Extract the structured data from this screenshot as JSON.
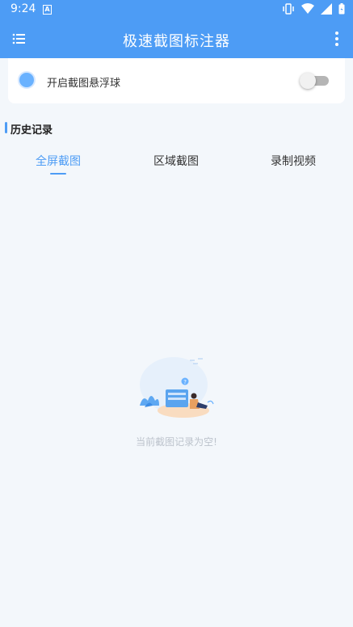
{
  "status_bar": {
    "time": "9:24",
    "notification_letter": "A"
  },
  "app_bar": {
    "title": "极速截图标注器",
    "menu_icon": "menu-icon",
    "more_icon": "more-vert-icon"
  },
  "float_ball": {
    "label": "开启截图悬浮球",
    "enabled": false
  },
  "history": {
    "title": "历史记录",
    "tabs": [
      {
        "label": "全屏截图",
        "active": true
      },
      {
        "label": "区域截图",
        "active": false
      },
      {
        "label": "录制视频",
        "active": false
      }
    ]
  },
  "empty_state": {
    "message": "当前截图记录为空!"
  },
  "colors": {
    "primary": "#4d9cf5",
    "background": "#f3f7fb",
    "toggle_off": "#b5b5b5"
  }
}
